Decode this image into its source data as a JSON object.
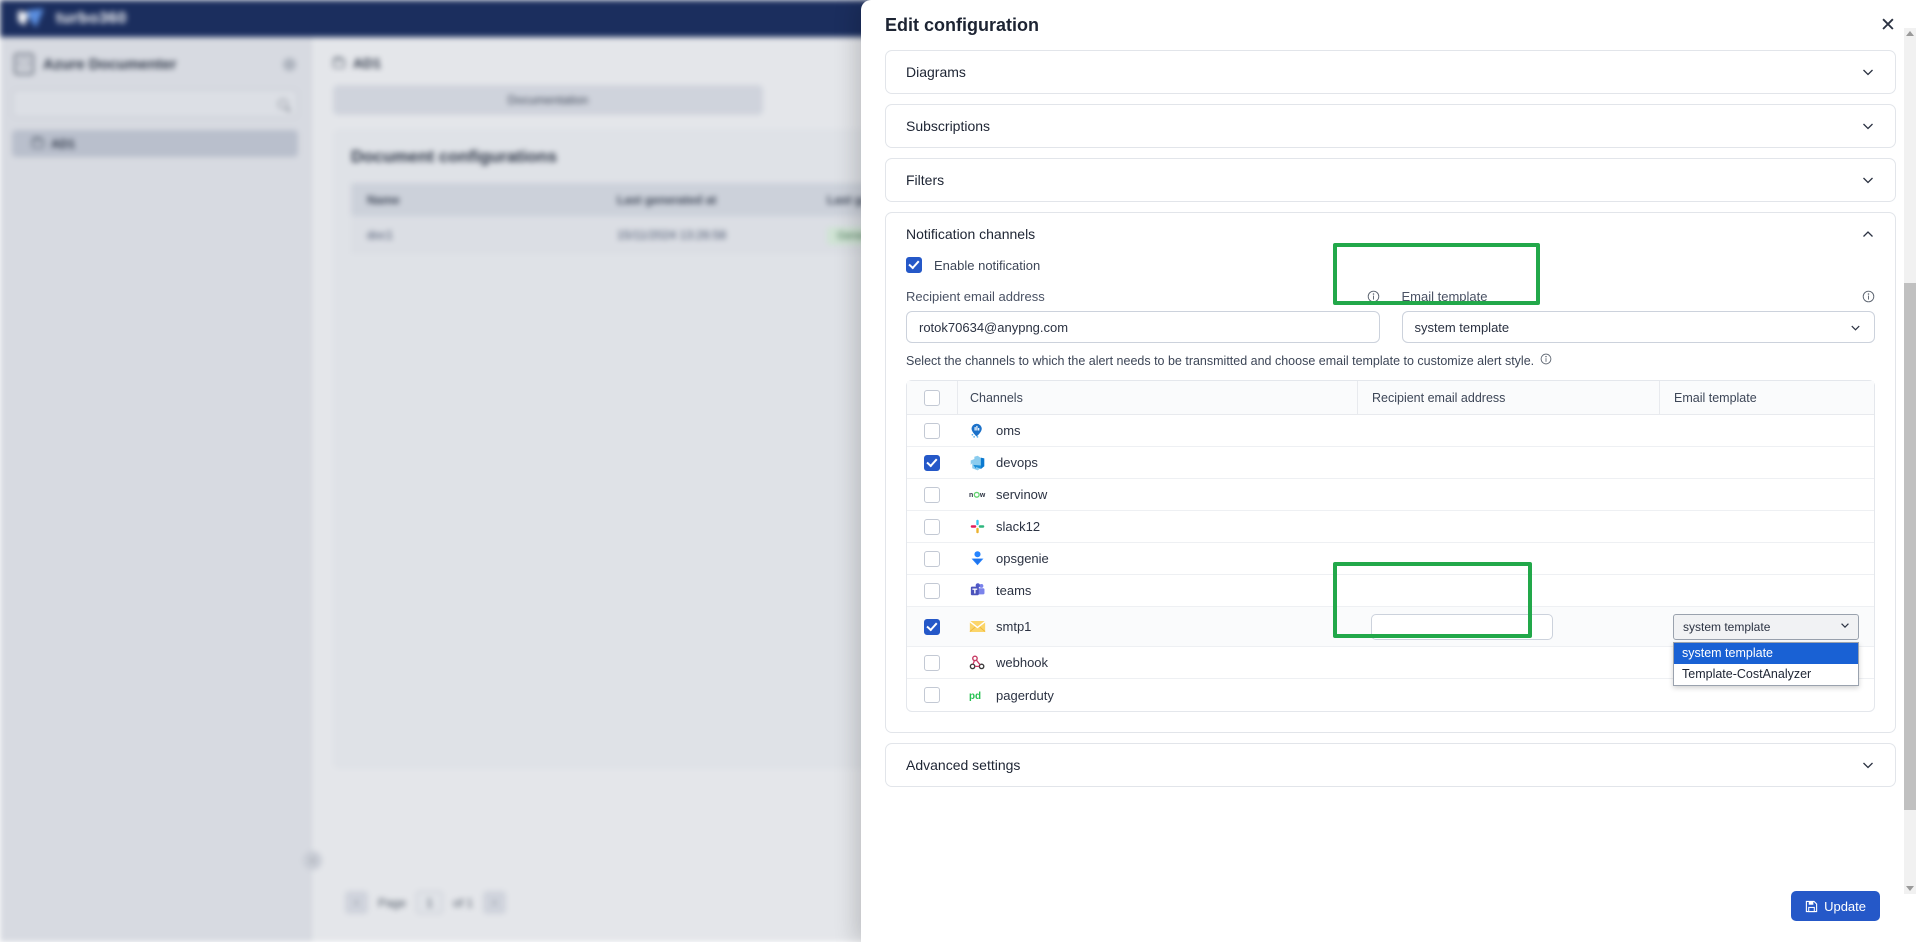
{
  "background": {
    "brand": "turbo360",
    "sidebar": {
      "title": "Azure Documenter",
      "search_placeholder": "",
      "items": [
        {
          "label": "AD1"
        }
      ]
    },
    "breadcrumb": "AD1",
    "tab": "Documentation",
    "card_title": "Document configurations",
    "table": {
      "headers": [
        "Name",
        "Last generated at",
        "Last generated"
      ],
      "rows": [
        {
          "name": "doc1",
          "last_generated_at": "15/11/2024 13:26:58",
          "status": "Generated"
        }
      ]
    },
    "pagination": {
      "prev": "‹",
      "label": "Page",
      "page": "1",
      "of": "of 1",
      "next": "›"
    }
  },
  "modal": {
    "title": "Edit configuration",
    "close_label": "✕",
    "sections": [
      {
        "name": "diagrams",
        "label": "Diagrams",
        "expanded": false
      },
      {
        "name": "subscriptions",
        "label": "Subscriptions",
        "expanded": false
      },
      {
        "name": "filters",
        "label": "Filters",
        "expanded": false
      },
      {
        "name": "notification-channels",
        "label": "Notification channels",
        "expanded": true
      },
      {
        "name": "advanced-settings",
        "label": "Advanced settings",
        "expanded": false
      }
    ],
    "notification": {
      "enable_label": "Enable notification",
      "enable_checked": true,
      "recipient_label": "Recipient email address",
      "recipient_value": "rotok70634@anypng.com",
      "template_label": "Email template",
      "template_value": "system template",
      "hint": "Select the channels to which the alert needs to be transmitted and choose email template to customize alert style.",
      "table_headers": {
        "channels": "Channels",
        "recipient": "Recipient email address",
        "template": "Email template"
      },
      "select_all_checked": false,
      "rows": [
        {
          "name": "oms",
          "icon": "oms-icon",
          "checked": false,
          "has_inputs": false
        },
        {
          "name": "devops",
          "icon": "devops-icon",
          "checked": true,
          "has_inputs": false
        },
        {
          "name": "servinow",
          "icon": "servicenow-icon",
          "checked": false,
          "has_inputs": false
        },
        {
          "name": "slack12",
          "icon": "slack-icon",
          "checked": false,
          "has_inputs": false
        },
        {
          "name": "opsgenie",
          "icon": "opsgenie-icon",
          "checked": false,
          "has_inputs": false
        },
        {
          "name": "teams",
          "icon": "teams-icon",
          "checked": false,
          "has_inputs": false
        },
        {
          "name": "smtp1",
          "icon": "smtp-icon",
          "checked": true,
          "has_inputs": true,
          "recipient_value": "",
          "template_value": "system template"
        },
        {
          "name": "webhook",
          "icon": "webhook-icon",
          "checked": false,
          "has_inputs": false
        },
        {
          "name": "pagerduty",
          "icon": "pagerduty-icon",
          "checked": false,
          "has_inputs": false
        }
      ],
      "dropdown_open": true,
      "dropdown_options": [
        {
          "label": "system template",
          "selected": true
        },
        {
          "label": "Template-CostAnalyzer",
          "selected": false
        }
      ]
    },
    "footer": {
      "update_label": "Update",
      "update_icon": "save-icon"
    }
  },
  "colors": {
    "brand_navy": "#1b2e5e",
    "primary_blue": "#2558c8",
    "highlight_green": "#22a84a",
    "dropdown_active": "#1961d4"
  }
}
